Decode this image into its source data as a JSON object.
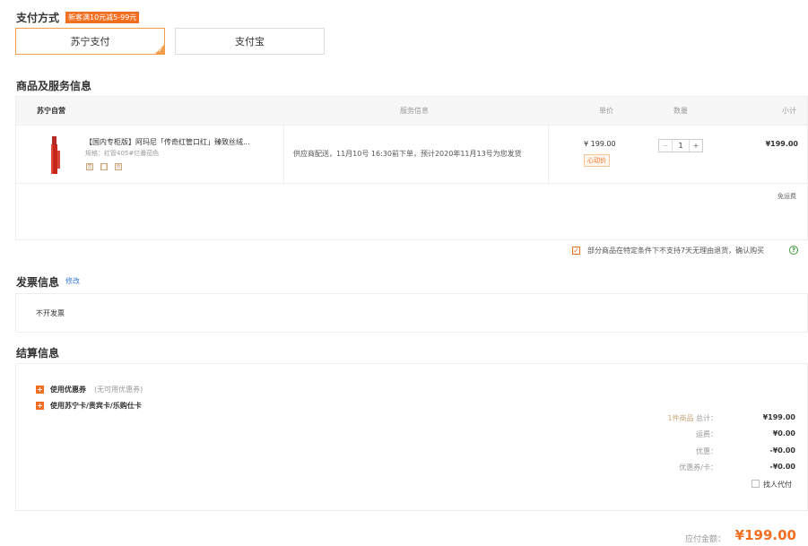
{
  "payment": {
    "title": "支付方式",
    "promo": "新客满10元减5-99元",
    "methods": [
      {
        "label": "苏宁支付",
        "selected": true
      },
      {
        "label": "支付宝",
        "selected": false
      }
    ]
  },
  "goods": {
    "title": "商品及服务信息",
    "headers": {
      "store": "苏宁自营",
      "service": "服务信息",
      "price": "单价",
      "qty": "数量",
      "subtotal": "小计"
    },
    "item": {
      "name": "【国内专柜版】阿玛尼「传奇红管口红」臻致丝绒...",
      "spec": "规格：红管405#烂番茄色",
      "service": "供应商配送，11月10号 16:30前下单，预计2020年11月13号为您发货",
      "price": "¥ 199.00",
      "price_tag": "心动价",
      "qty": "1",
      "qty_minus": "−",
      "qty_plus": "+",
      "subtotal": "¥199.00",
      "tags": [
        "贵",
        "门",
        "票"
      ]
    },
    "shipping": "免运费",
    "return_notice": "部分商品在特定条件下不支持7天无理由退货，确认购买",
    "help_icon": "?"
  },
  "invoice": {
    "title": "发票信息",
    "edit_link": "修改",
    "value": "不开发票"
  },
  "settlement": {
    "title": "结算信息",
    "coupon_label": "使用优惠券",
    "coupon_note": "(无可用优惠券)",
    "card_label": "使用苏宁卡/贵宾卡/乐购仕卡",
    "summary": [
      {
        "label_prefix": "1件商品",
        "label": " 总计：",
        "value": "¥199.00"
      },
      {
        "label_prefix": "",
        "label": "运费：",
        "value": "¥0.00"
      },
      {
        "label_prefix": "",
        "label": "优惠：",
        "value": "-¥0.00"
      },
      {
        "label_prefix": "",
        "label": "优惠券/卡：",
        "value": "-¥0.00"
      }
    ],
    "proxy_pay": "找人代付",
    "total_label": "应付金额：",
    "total_value": "¥199.00"
  },
  "colors": {
    "accent": "#f26e21",
    "border_selected": "#f29c49"
  }
}
